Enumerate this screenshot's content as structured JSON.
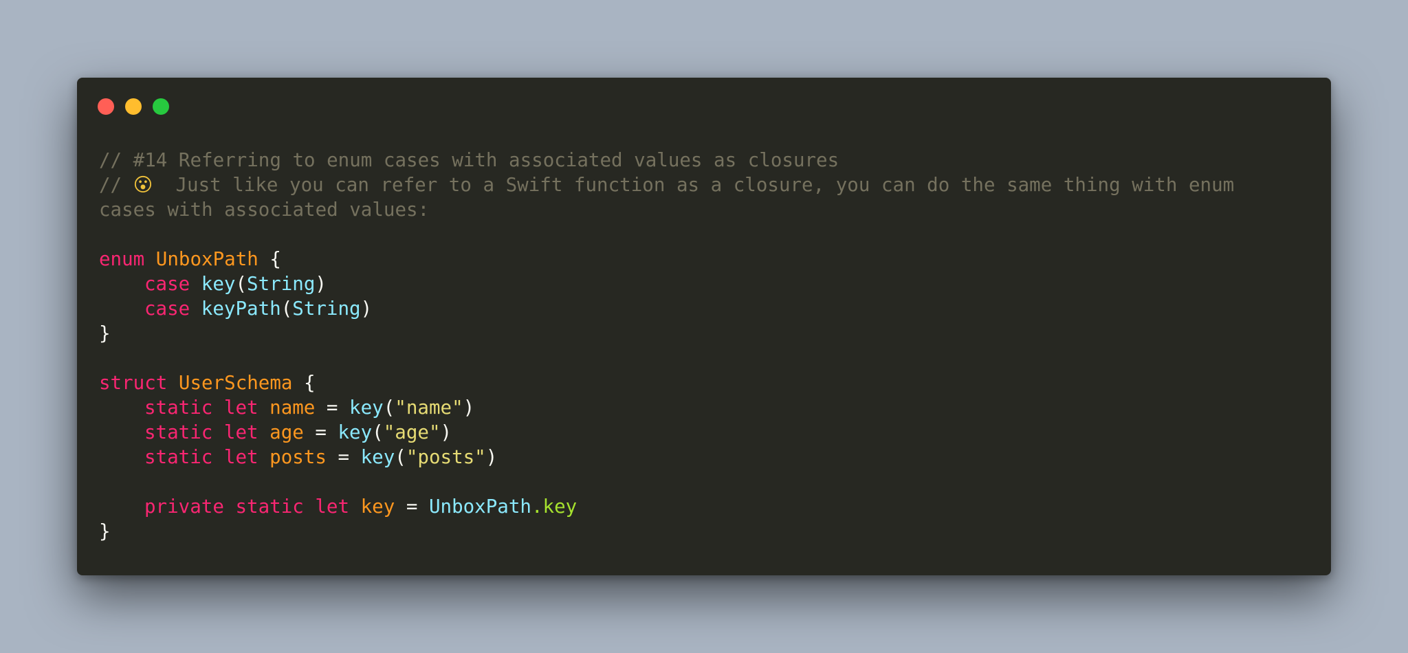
{
  "window": {
    "controls": [
      "close",
      "minimize",
      "maximize"
    ]
  },
  "code": {
    "comment_1": "// #14 Referring to enum cases with associated values as closures",
    "comment_2_prefix": "// ",
    "comment_2_emoji": "😮",
    "comment_2_text": "  Just like you can refer to a Swift function as a closure, you can do the same thing with enum",
    "comment_3": "cases with associated values:",
    "enum_keyword": "enum",
    "enum_name": "UnboxPath",
    "open_brace": "{",
    "close_brace": "}",
    "case_keyword": "case",
    "case_1_name": "key",
    "case_2_name": "keyPath",
    "assoc_type": "String",
    "struct_keyword": "struct",
    "struct_name": "UserSchema",
    "static_keyword": "static",
    "let_keyword": "let",
    "private_keyword": "private",
    "prop_1": "name",
    "prop_2": "age",
    "prop_3": "posts",
    "call_fn": "key",
    "str_1": "\"name\"",
    "str_2": "\"age\"",
    "str_3": "\"posts\"",
    "private_prop": "key",
    "assign_type": "UnboxPath",
    "assign_member": ".key"
  },
  "colors": {
    "background": "#a9b4c2",
    "editor": "#272822",
    "comment": "#75715e",
    "keyword": "#f92672",
    "type_name": "#fd971f",
    "function": "#8be9fd",
    "string": "#e6db74",
    "member": "#a6e22e"
  }
}
